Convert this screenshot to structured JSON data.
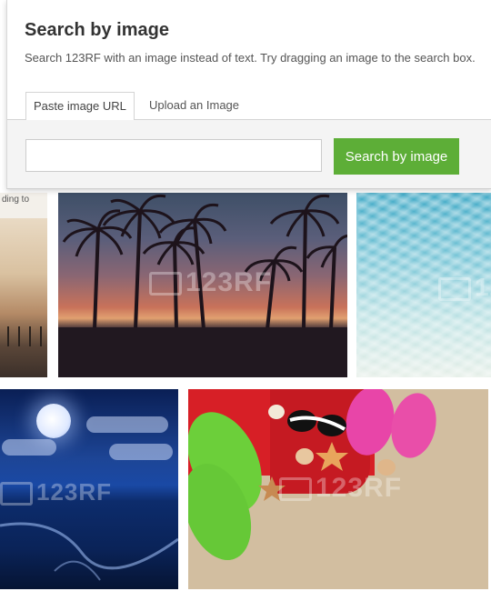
{
  "modal": {
    "title": "Search by image",
    "description": "Search 123RF with an image instead of text. Try dragging an image to the search box.",
    "tabs": [
      {
        "label": "Paste image URL",
        "active": true
      },
      {
        "label": "Upload an Image",
        "active": false
      }
    ],
    "url_input": {
      "value": "",
      "placeholder": ""
    },
    "search_button_label": "Search by image"
  },
  "background": {
    "left_fragment_text": "ding to",
    "watermark_text": "123RF"
  },
  "colors": {
    "accent_button": "#5dae37",
    "title_text": "#333333"
  }
}
